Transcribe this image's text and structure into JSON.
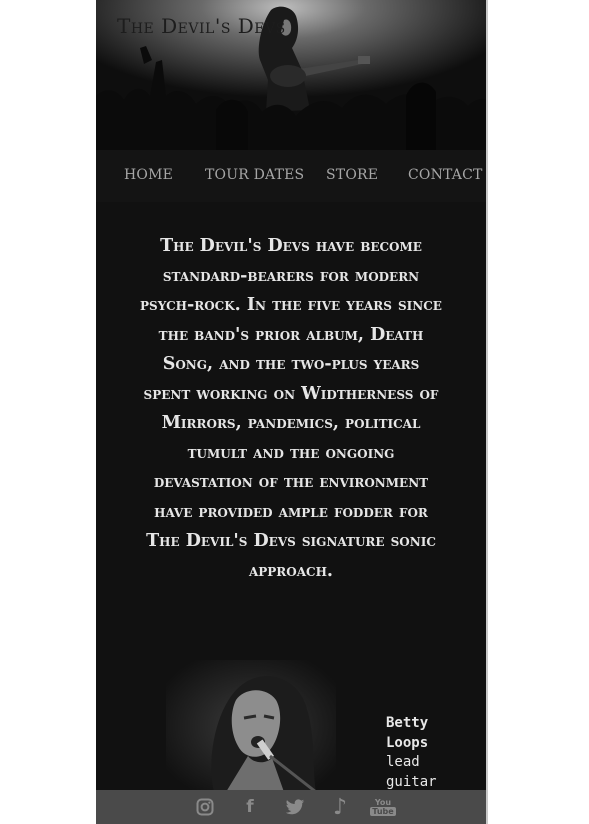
{
  "site": {
    "title": "The Devil's Devs"
  },
  "nav": {
    "items": [
      {
        "label": "HOME"
      },
      {
        "label": "TOUR DATES"
      },
      {
        "label": "STORE"
      },
      {
        "label": "CONTACT"
      }
    ]
  },
  "intro": {
    "text": "The Devil's Devs have become standard-bearers for modern psych-rock. In the five years since the band's prior album, Death Song, and the two-plus years spent working on Widtherness of Mirrors, pandemics, political tumult and the ongoing devastation of the environment have provided ample fodder for The Devil's Devs signature sonic approach."
  },
  "member": {
    "name": "Betty Loops",
    "role": "lead guitar"
  },
  "footer": {
    "social": [
      {
        "icon": "instagram-icon"
      },
      {
        "icon": "facebook-icon",
        "glyph": "f"
      },
      {
        "icon": "twitter-icon"
      },
      {
        "icon": "music-note-icon",
        "glyph": "♪"
      },
      {
        "icon": "youtube-icon",
        "glyph_top": "You",
        "glyph_bottom": "Tube"
      }
    ]
  },
  "colors": {
    "background": "#111111",
    "nav_text": "#a6a6a6",
    "body_text": "#e6e6e6",
    "footer_bg": "#4a4a4a",
    "icon": "#8a8a8a"
  }
}
